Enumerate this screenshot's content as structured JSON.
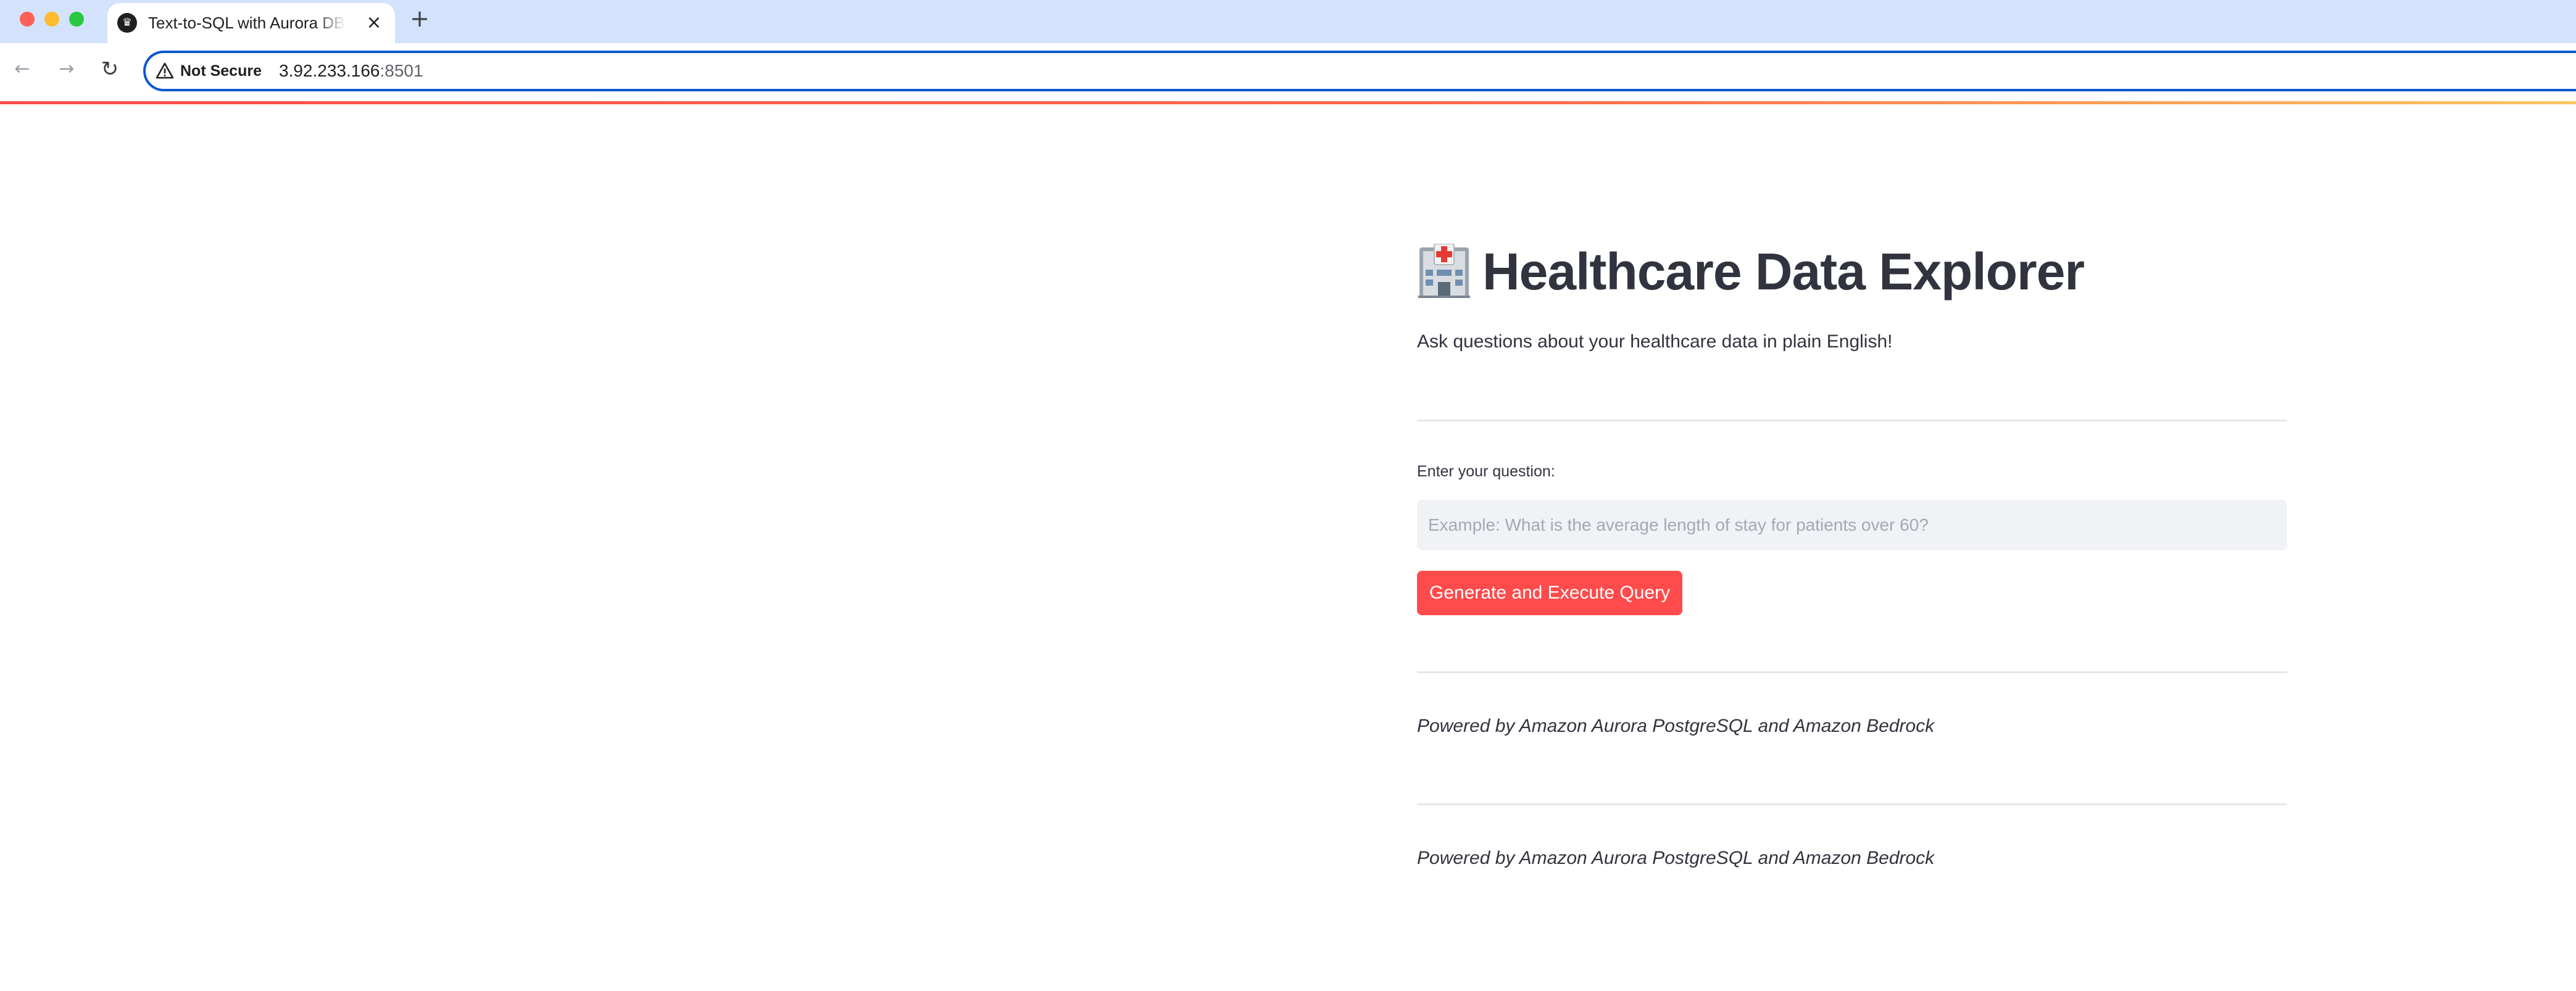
{
  "browser": {
    "tab_title": "Text-to-SQL with Aurora DB for Healthcare",
    "security_label": "Not Secure",
    "url_host": "3.92.233.166",
    "url_port": ":8501"
  },
  "icons": {
    "favicon": "streamlit-crown-icon",
    "tab_close": "close-icon",
    "new_tab": "plus-icon",
    "back": "arrow-left-icon",
    "forward": "arrow-right-icon",
    "reload": "reload-icon",
    "security": "warning-triangle-icon",
    "title_emoji": "hospital-icon"
  },
  "app": {
    "title": "Healthcare Data Explorer",
    "subtitle": "Ask questions about your healthcare data in plain English!",
    "question_label": "Enter your question:",
    "question_value": "",
    "question_placeholder": "Example: What is the average length of stay for patients over 60?",
    "button_label": "Generate and Execute Query",
    "footer_1": "Powered by Amazon Aurora PostgreSQL and Amazon Bedrock",
    "footer_2": "Powered by Amazon Aurora PostgreSQL and Amazon Bedrock"
  },
  "colors": {
    "tab_strip": "#d3e3fd",
    "accent_button": "#ff4b4b",
    "text": "#31333f",
    "input_bg": "#f0f2f6",
    "focus_ring": "#0b57d0"
  }
}
